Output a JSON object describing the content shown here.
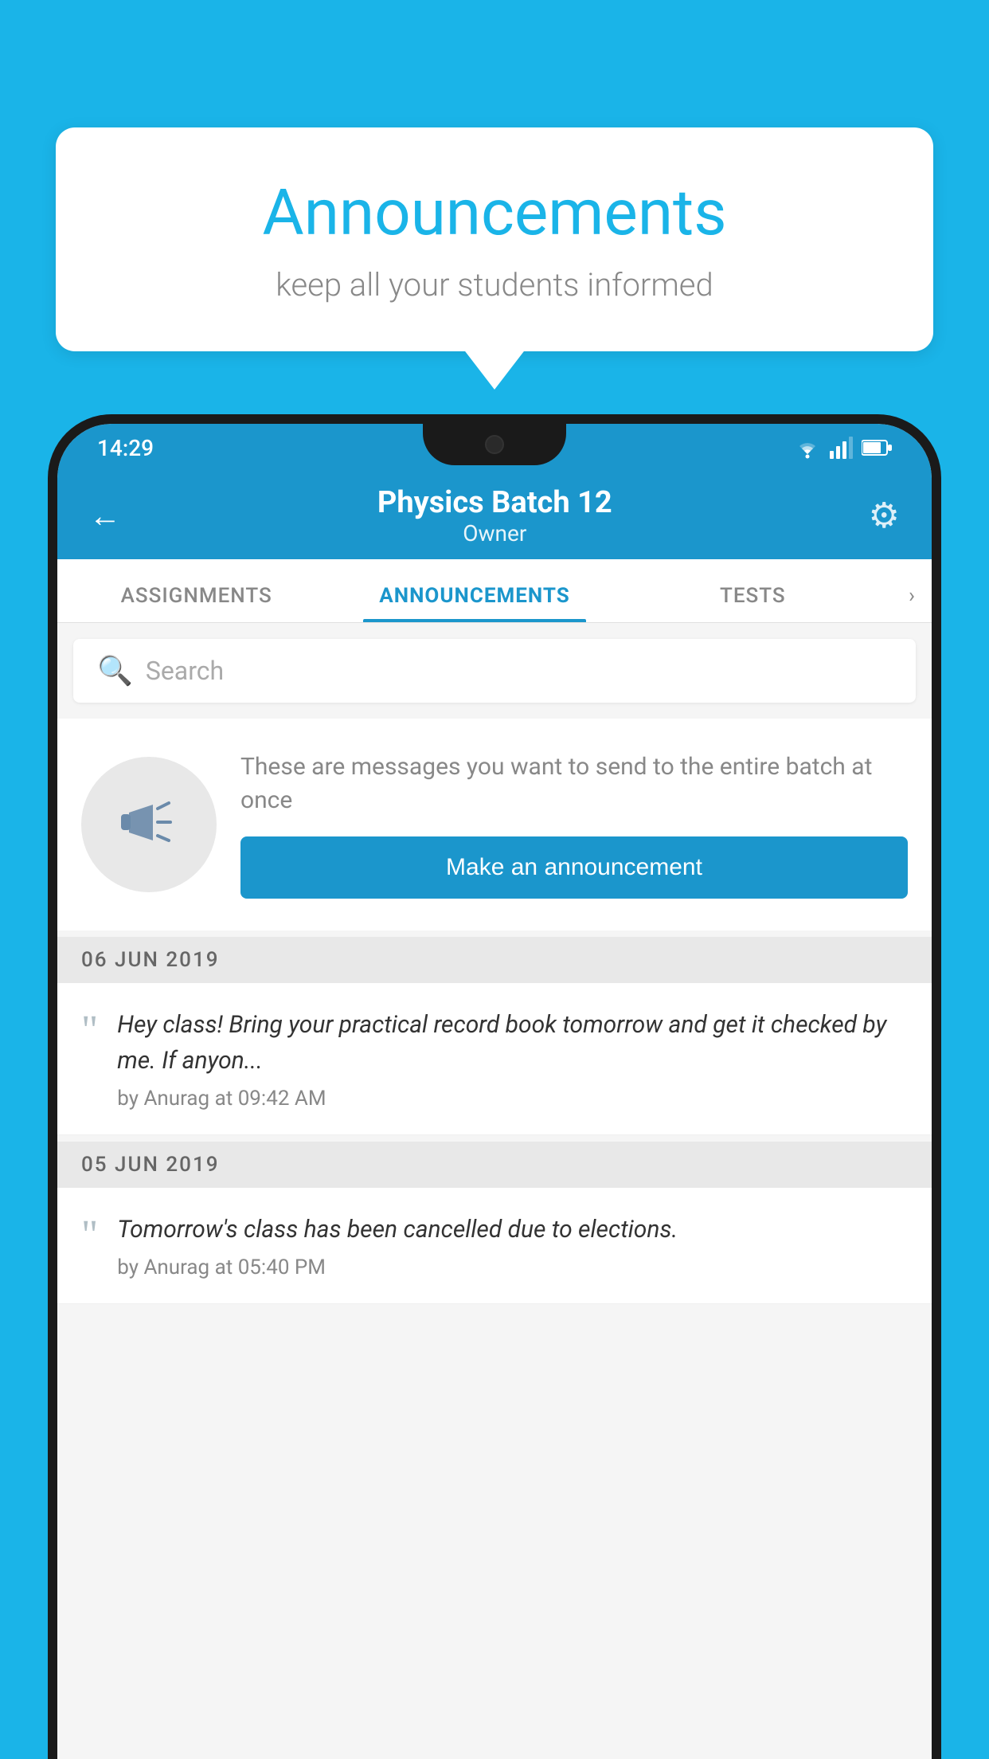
{
  "speech_bubble": {
    "title": "Announcements",
    "subtitle": "keep all your students informed"
  },
  "status_bar": {
    "time": "14:29"
  },
  "header": {
    "title": "Physics Batch 12",
    "subtitle": "Owner",
    "back_label": "←",
    "gear_label": "⚙"
  },
  "tabs": [
    {
      "label": "ASSIGNMENTS",
      "active": false
    },
    {
      "label": "ANNOUNCEMENTS",
      "active": true
    },
    {
      "label": "TESTS",
      "active": false
    }
  ],
  "search": {
    "placeholder": "Search"
  },
  "announcement_prompt": {
    "description": "These are messages you want to send to the entire batch at once",
    "button_label": "Make an announcement"
  },
  "announcements": [
    {
      "date": "06  JUN  2019",
      "text": "Hey class! Bring your practical record book tomorrow and get it checked by me. If anyon...",
      "author": "by Anurag at 09:42 AM"
    },
    {
      "date": "05  JUN  2019",
      "text": "Tomorrow's class has been cancelled due to elections.",
      "author": "by Anurag at 05:40 PM"
    }
  ],
  "colors": {
    "primary": "#1b96cc",
    "background": "#1ab4e8",
    "white": "#ffffff"
  }
}
